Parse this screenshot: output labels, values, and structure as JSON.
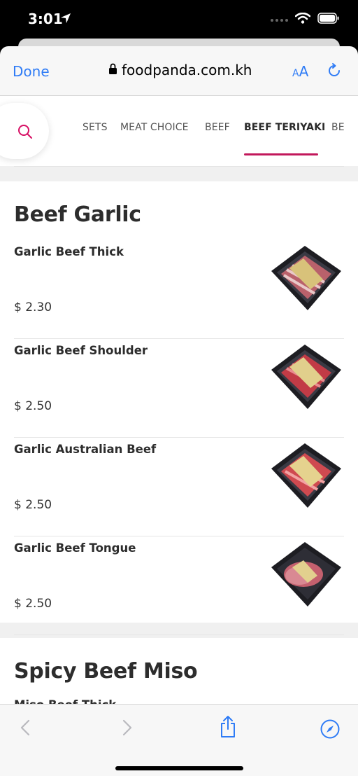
{
  "status": {
    "time": "3:01"
  },
  "browser": {
    "done_label": "Done",
    "url": "foodpanda.com.kh",
    "text_size_small": "A",
    "text_size_big": "A",
    "accent": "#2f7cf6"
  },
  "categories": {
    "tabs": [
      "SETS",
      "MEAT CHOICE",
      "BEEF",
      "BEEF TERIYAKI",
      "BE"
    ],
    "active": "BEEF TERIYAKI",
    "underline_color": "#c2185b"
  },
  "sections": [
    {
      "title": "Beef Garlic",
      "items": [
        {
          "name": "Garlic Beef Thick",
          "price": "$ 2.30"
        },
        {
          "name": "Garlic Beef Shoulder",
          "price": "$ 2.50"
        },
        {
          "name": "Garlic Australian Beef",
          "price": "$ 2.50"
        },
        {
          "name": "Garlic Beef Tongue",
          "price": "$ 2.50"
        }
      ]
    },
    {
      "title": "Spicy Beef Miso",
      "partial_item": "Miso Beef Thick"
    }
  ],
  "icons": {
    "search": "search-icon",
    "lock": "lock-icon",
    "reload": "reload-icon",
    "back": "chevron-left-icon",
    "forward": "chevron-right-icon",
    "share": "share-icon",
    "compass": "compass-icon"
  }
}
